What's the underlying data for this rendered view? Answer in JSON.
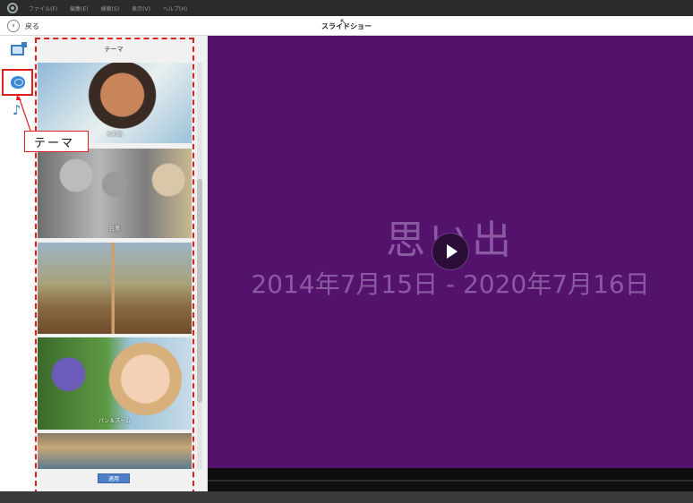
{
  "menubar": {
    "items": [
      "ファイル(F)",
      "編集(E)",
      "検索(S)",
      "表示(V)",
      "ヘルプ(H)"
    ]
  },
  "header": {
    "back_label": "戻る",
    "title": "スライドショー"
  },
  "sidebar": {
    "icons": [
      "photo-icon",
      "theme-icon",
      "music-icon"
    ],
    "selected": "theme"
  },
  "callout": {
    "text": "テーマ",
    "color": "#e01e1e"
  },
  "panel": {
    "title": "テーマ",
    "themes": [
      {
        "label": "水彩画"
      },
      {
        "label": "白黒"
      },
      {
        "label": ""
      },
      {
        "label": "パン＆ズーム"
      },
      {
        "label": ""
      }
    ],
    "apply_label": "適用"
  },
  "preview": {
    "title": "思い出",
    "date_range": "2014年7月15日 - 2020年7月16日",
    "background": "#53136c"
  },
  "colors": {
    "accent": "#4d7fc9",
    "highlight": "#e01e1e"
  }
}
